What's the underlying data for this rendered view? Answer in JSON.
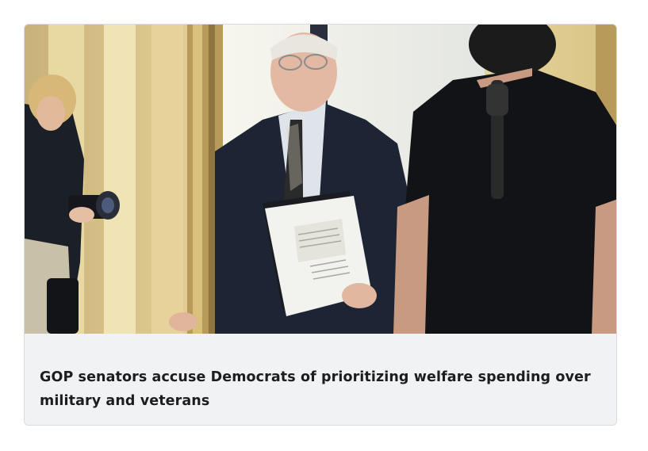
{
  "article": {
    "headline": "GOP senators accuse Democrats of prioritizing welfare spending over military and veterans"
  }
}
